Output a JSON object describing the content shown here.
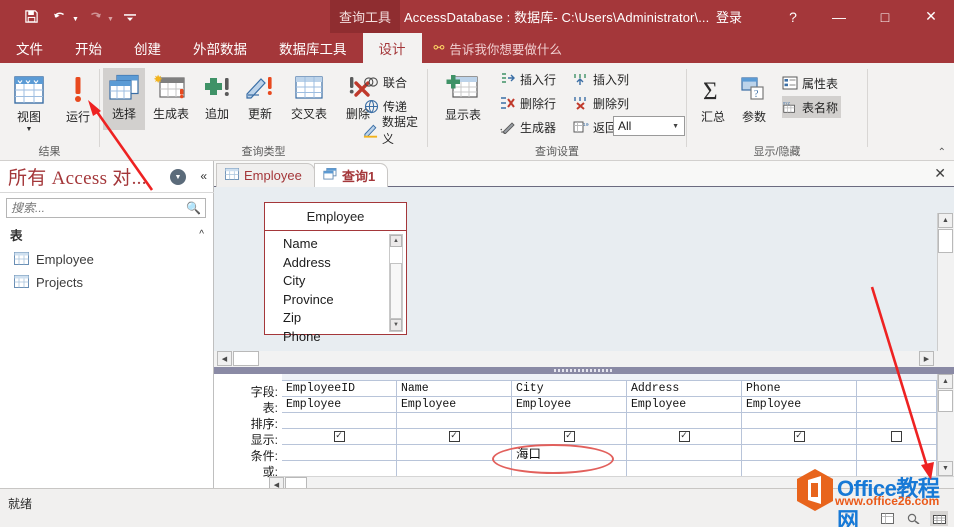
{
  "window": {
    "context_tab": "查询工具",
    "title": "AccessDatabase : 数据库- C:\\Users\\Administrator\\...",
    "signin": "登录",
    "help": "?",
    "minimize": "—",
    "maximize": "□",
    "close": "✕"
  },
  "quick_access": {
    "save": "save-icon",
    "undo": "undo-icon",
    "redo": "redo-icon",
    "customize": "customize-icon"
  },
  "ribbon": {
    "tabs": [
      {
        "label": "文件",
        "active": false
      },
      {
        "label": "开始",
        "active": false
      },
      {
        "label": "创建",
        "active": false
      },
      {
        "label": "外部数据",
        "active": false
      },
      {
        "label": "数据库工具",
        "active": false
      },
      {
        "label": "设计",
        "active": true
      }
    ],
    "tellme": "告诉我你想要做什么",
    "groups": [
      {
        "name": "结果",
        "buttons": [
          {
            "label": "视图",
            "icon": "view-table-icon",
            "has_dropdown": true
          },
          {
            "label": "运行",
            "icon": "run-exclamation-icon",
            "has_dropdown": false
          }
        ]
      },
      {
        "name": "查询类型",
        "buttons": [
          {
            "label": "选择",
            "icon": "select-query-icon",
            "selected": true
          },
          {
            "label": "生成表",
            "icon": "make-table-query-icon",
            "selected": false
          },
          {
            "label": "追加",
            "icon": "append-query-icon",
            "selected": false
          },
          {
            "label": "更新",
            "icon": "update-query-icon",
            "selected": false
          },
          {
            "label": "交叉表",
            "icon": "crosstab-query-icon",
            "selected": false
          },
          {
            "label": "删除",
            "icon": "delete-query-icon",
            "selected": false
          },
          {
            "label": "联合",
            "icon": "union-icon",
            "selected": false
          },
          {
            "label": "传递",
            "icon": "passthrough-icon",
            "selected": false
          },
          {
            "label": "数据定义",
            "icon": "data-definition-icon",
            "selected": false
          }
        ]
      },
      {
        "name": "查询设置",
        "buttons": [
          {
            "label": "显示表",
            "icon": "show-table-icon"
          },
          {
            "label": "插入行",
            "icon": "insert-row-icon"
          },
          {
            "label": "删除行",
            "icon": "delete-row-icon"
          },
          {
            "label": "生成器",
            "icon": "builder-icon"
          },
          {
            "label": "插入列",
            "icon": "insert-column-icon"
          },
          {
            "label": "删除列",
            "icon": "delete-column-icon"
          },
          {
            "label": "返回:",
            "icon": "return-rows-icon"
          }
        ],
        "return_value": "All"
      },
      {
        "name": "显示/隐藏",
        "buttons": [
          {
            "label": "汇总",
            "icon": "totals-sigma-icon"
          },
          {
            "label": "参数",
            "icon": "parameters-icon"
          },
          {
            "label": "属性表",
            "icon": "property-sheet-icon",
            "selected": false
          },
          {
            "label": "表名称",
            "icon": "table-names-icon",
            "selected": true
          }
        ]
      }
    ],
    "collapse": "⌃"
  },
  "nav_pane": {
    "title": "所有 Access 对...",
    "dropdown_icon": "chevron-down-circle-icon",
    "collapse_icon": "double-chevron-left-icon",
    "search_placeholder": "搜索...",
    "search_value": "",
    "search_icon": "search-icon",
    "group": {
      "label": "表",
      "collapse_icon": "double-chevron-up-icon"
    },
    "items": [
      {
        "label": "Employee",
        "icon": "table-icon"
      },
      {
        "label": "Projects",
        "icon": "table-icon"
      }
    ]
  },
  "document_tabs": [
    {
      "label": "Employee",
      "icon": "table-icon",
      "active": false
    },
    {
      "label": "查询1",
      "icon": "query-icon",
      "active": true
    }
  ],
  "tab_close": "✕",
  "design_surface": {
    "field_list": {
      "title": "Employee",
      "fields": [
        "Name",
        "Address",
        "City",
        "Province",
        "Zip",
        "Phone"
      ]
    }
  },
  "query_grid": {
    "row_headers": [
      "字段:",
      "表:",
      "排序:",
      "显示:",
      "条件:",
      "或:"
    ],
    "columns": [
      {
        "field": "EmployeeID",
        "table": "Employee",
        "sort": "",
        "show": true,
        "criteria": "",
        "or": ""
      },
      {
        "field": "Name",
        "table": "Employee",
        "sort": "",
        "show": true,
        "criteria": "",
        "or": ""
      },
      {
        "field": "City",
        "table": "Employee",
        "sort": "",
        "show": true,
        "criteria": "海口",
        "or": ""
      },
      {
        "field": "Address",
        "table": "Employee",
        "sort": "",
        "show": true,
        "criteria": "",
        "or": ""
      },
      {
        "field": "Phone",
        "table": "Employee",
        "sort": "",
        "show": true,
        "criteria": "",
        "or": ""
      },
      {
        "field": "",
        "table": "",
        "sort": "",
        "show": false,
        "criteria": "",
        "or": ""
      }
    ],
    "checkbox_glyph": "✓",
    "highlight_color": "#e2605c"
  },
  "status_bar": {
    "text": "就绪",
    "views": [
      "datasheet-view-icon",
      "sql-view-icon",
      "design-view-icon"
    ]
  },
  "watermark": {
    "brand": "Office教程网",
    "url": "www.office26.com",
    "brand_color": "#1779d6",
    "url_color": "#ea5a1a",
    "logo_color": "#e8641c"
  },
  "annotations": {
    "arrow_color": "#ee2222",
    "arrows": [
      "arrow-pointing-to-run-button",
      "arrow-pointing-to-grid-scroll"
    ]
  }
}
